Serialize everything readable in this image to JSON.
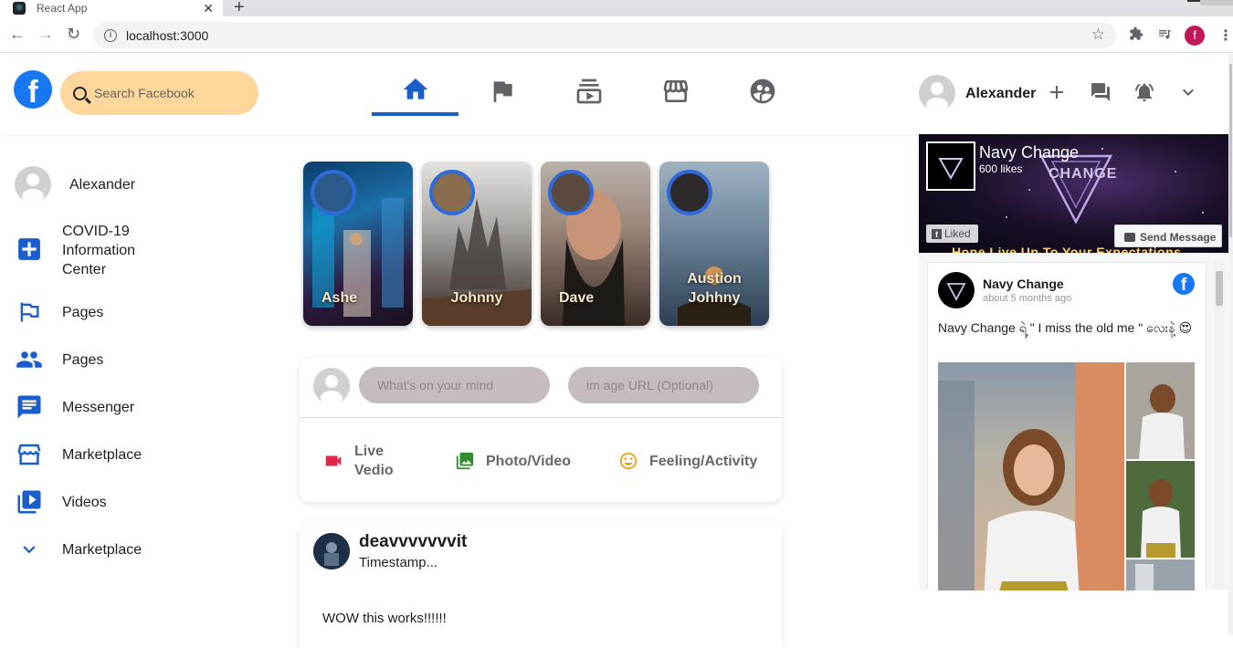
{
  "browser": {
    "tab_title": "React App",
    "url": "localhost:3000",
    "profile_letter": "f"
  },
  "header": {
    "search_placeholder": "Search Facebook",
    "user_name": "Alexander",
    "nav": [
      "home-icon",
      "flag-icon",
      "watch-icon",
      "marketplace-icon",
      "groups-icon"
    ],
    "accent": "#1a5ecb"
  },
  "sidebar": {
    "items": [
      {
        "label": "Alexander",
        "icon": "avatar"
      },
      {
        "label": "COVID-19 Information Center",
        "icon": "covid-plus-icon"
      },
      {
        "label": "Pages",
        "icon": "flag-icon"
      },
      {
        "label": "Pages",
        "icon": "people-icon"
      },
      {
        "label": "Messenger",
        "icon": "chat-icon"
      },
      {
        "label": "Marketplace",
        "icon": "storefront-icon"
      },
      {
        "label": "Videos",
        "icon": "video-library-icon"
      },
      {
        "label": "Marketplace",
        "icon": "chevron-down-icon"
      }
    ],
    "covid_line1": "COVID-19",
    "covid_line2": "Information",
    "covid_line3": "Center"
  },
  "stories": [
    {
      "name": "Ashe"
    },
    {
      "name": "Johnny"
    },
    {
      "name": "Dave"
    },
    {
      "name_line1": "Austion",
      "name_line2": "Johhny"
    }
  ],
  "composer": {
    "message_placeholder": "What's on your mind",
    "image_placeholder": "im age URL (Optional)",
    "options": [
      {
        "label_line1": "Live",
        "label_line2": "Vedio",
        "icon": "videocam-icon",
        "color": "#e42645"
      },
      {
        "label": "Photo/Video",
        "icon": "photo-library-icon",
        "color": "#2e8b2e"
      },
      {
        "label": "Feeling/Activity",
        "icon": "smile-icon",
        "color": "#e8a317"
      }
    ]
  },
  "post": {
    "author": "deavvvvvvvit",
    "timestamp": "Timestamp...",
    "message": "WOW this works!!!!!!"
  },
  "page_widget": {
    "page_name": "Navy Change",
    "likes": "600 likes",
    "liked_label": "Liked",
    "send_message_label": "Send Message",
    "cover_tagline": "Hope Live Up To Your Expectations",
    "cover_word": "CHANGE",
    "post_author": "Navy Change",
    "post_time": "about 5 months ago",
    "post_text": "Navy Change ရဲ့ \" I miss the old me \" လေးနဲ့ 😍"
  }
}
